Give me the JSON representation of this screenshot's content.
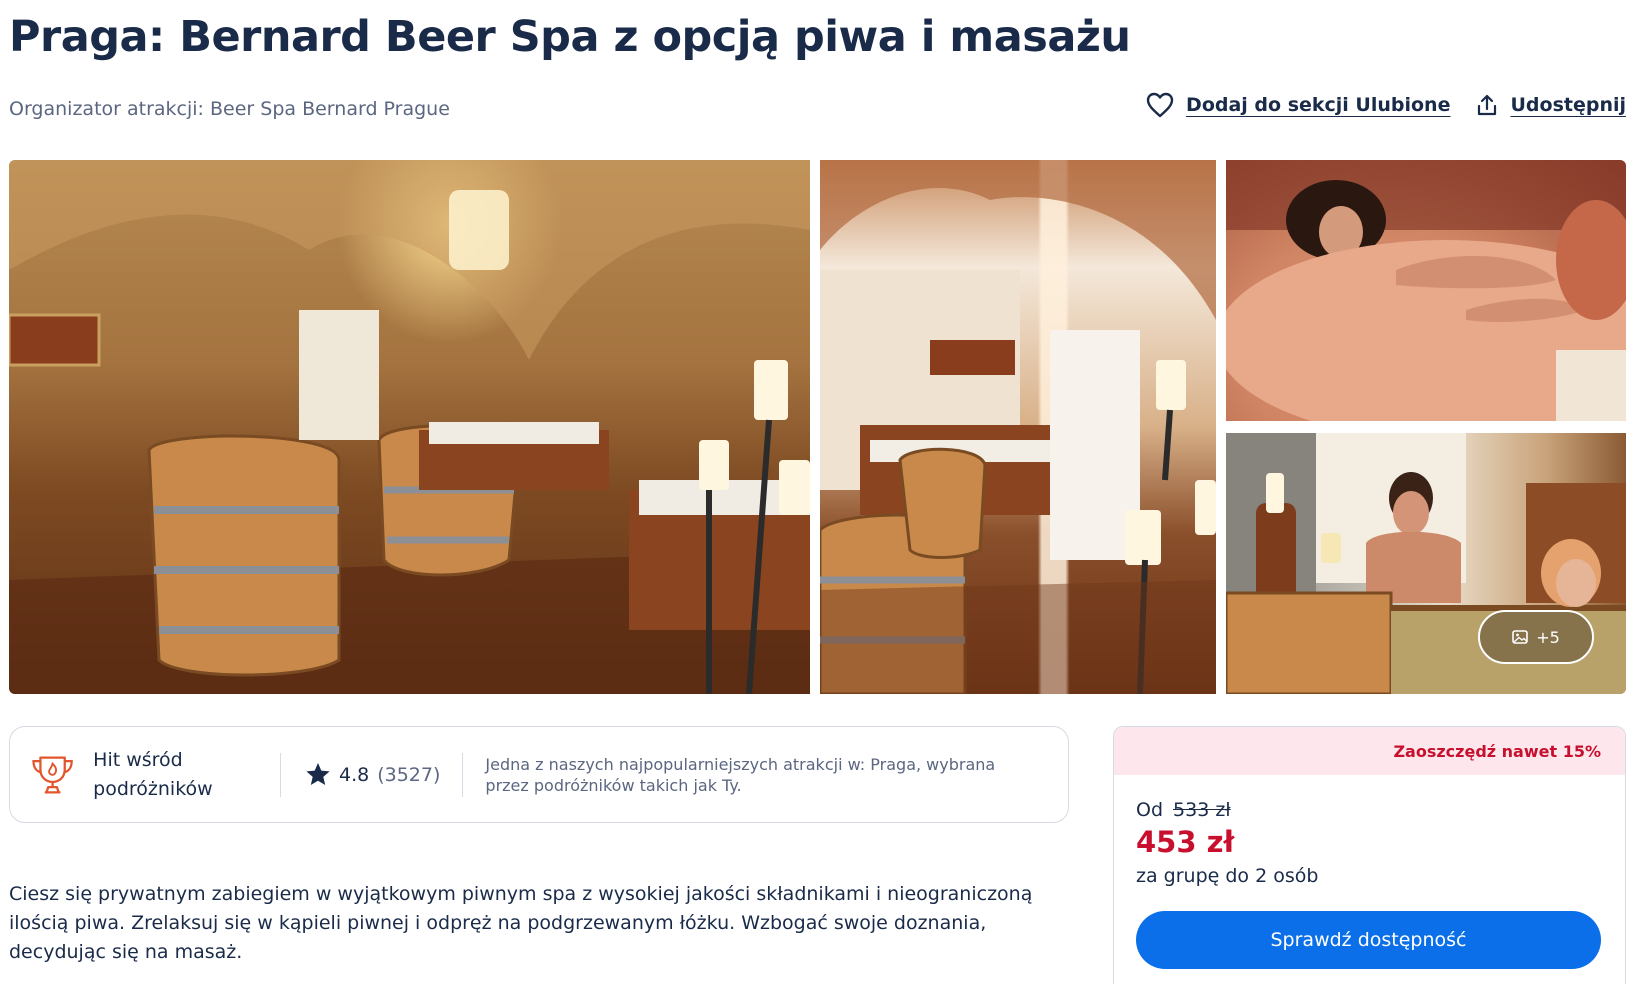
{
  "header": {
    "title": "Praga: Bernard Beer Spa z opcją piwa i masażu",
    "organizer_label": "Organizator atrakcji:",
    "organizer_name": "Beer Spa Bernard Prague"
  },
  "actions": {
    "favorite_label": "Dodaj do sekcji Ulubione",
    "share_label": "Udostępnij"
  },
  "gallery": {
    "more_photos_label": "+5",
    "photos": [
      "beer-spa-room",
      "beer-spa-room-view",
      "massage",
      "beer-bath-couple"
    ]
  },
  "badges": {
    "hit_label": "Hit wśród podróżników",
    "rating_value": "4.8",
    "rating_count": "(3527)",
    "popular_text": "Jedna z naszych najpopularniejszych atrakcji w: Praga, wybrana przez podróżników takich jak Ty."
  },
  "description": "Ciesz się prywatnym zabiegiem w wyjątkowym piwnym spa z wysokiej jakości składnikami i nieograniczoną ilością piwa. Zrelaksuj się w kąpieli piwnej i odpręż na podgrzewanym łóżku. Wzbogać swoje doznania, decydując się na masaż.",
  "pricing": {
    "savings_label": "Zaoszczędź nawet 15%",
    "from_label": "Od",
    "old_price": "533 zł",
    "new_price": "453 zł",
    "group_label": "za grupę do 2 osób",
    "cta_label": "Sprawdź dostępność"
  },
  "colors": {
    "text_primary": "#1a2b49",
    "text_secondary": "#5b6680",
    "sale_red": "#c8102e",
    "cta_blue": "#0a6fe8",
    "savings_bg": "#fde7ec",
    "hit_orange": "#e2552d"
  },
  "icons": [
    "heart-icon",
    "share-icon",
    "trophy-icon",
    "star-icon",
    "image-icon"
  ]
}
